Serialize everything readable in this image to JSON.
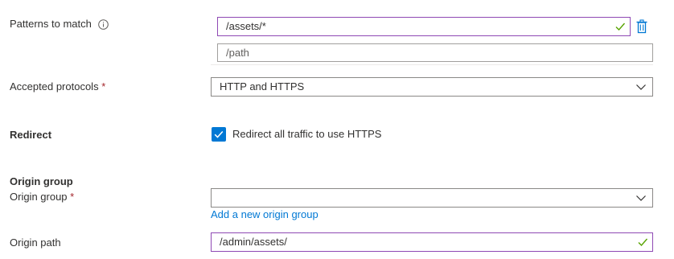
{
  "patterns": {
    "label": "Patterns to match",
    "info_icon": "info-icon",
    "rows": [
      {
        "value": "/assets/*",
        "placeholder": ""
      },
      {
        "value": "",
        "placeholder": "/path"
      }
    ],
    "delete_icon": "trash-icon",
    "valid_icon": "checkmark-icon"
  },
  "protocols": {
    "label": "Accepted protocols",
    "required_mark": "*",
    "selected": "HTTP and HTTPS",
    "chevron_icon": "chevron-down-icon"
  },
  "redirect": {
    "label": "Redirect",
    "checkbox_label": "Redirect all traffic to use HTTPS",
    "checked": true
  },
  "origin_group_section": {
    "heading": "Origin group",
    "label": "Origin group",
    "required_mark": "*",
    "selected": "",
    "add_link": "Add a new origin group"
  },
  "origin_path": {
    "label": "Origin path",
    "value": "/admin/assets/"
  },
  "colors": {
    "accent": "#0078d4",
    "valid_border": "#8f49b4",
    "valid_check": "#57a300",
    "required": "#a4262c"
  }
}
